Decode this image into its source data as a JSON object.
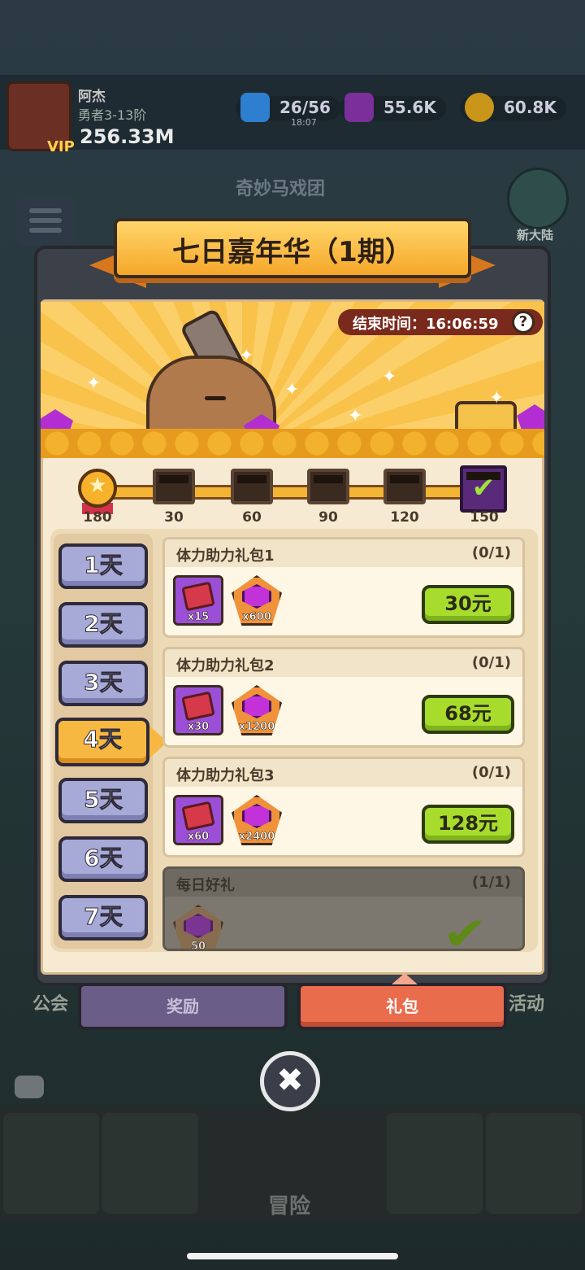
{
  "background": {
    "player_name": "阿杰",
    "player_rank": "勇者3-13阶",
    "vip_label": "VIP",
    "power": "256.33M",
    "stamina": "26/56",
    "stamina_timer": "18:07",
    "gems": "55.6K",
    "gold": "60.8K",
    "stage_title": "奇妙马戏团",
    "new_land_label": "新大陆",
    "guild_label": "公会",
    "activity_label": "活动",
    "adventure_label": "冒险"
  },
  "modal": {
    "title": "七日嘉年华（1期）",
    "end_time_label": "结束时间：16:06:59",
    "help_icon": "question-mark-icon"
  },
  "progress": {
    "current_points": 180,
    "milestones": [
      "30",
      "60",
      "90",
      "120",
      "150"
    ],
    "start_label": "180"
  },
  "days": [
    "1天",
    "2天",
    "3天",
    "4天",
    "5天",
    "6天",
    "7天"
  ],
  "active_day_index": 3,
  "offers": [
    {
      "title": "体力助力礼包1",
      "count": "(0/1)",
      "items": [
        {
          "icon": "ticket-icon",
          "qty": "x15"
        },
        {
          "icon": "gem-icon",
          "qty": "x600"
        }
      ],
      "price": "30元"
    },
    {
      "title": "体力助力礼包2",
      "count": "(0/1)",
      "items": [
        {
          "icon": "ticket-icon",
          "qty": "x30"
        },
        {
          "icon": "gem-icon",
          "qty": "x1200"
        }
      ],
      "price": "68元"
    },
    {
      "title": "体力助力礼包3",
      "count": "(0/1)",
      "items": [
        {
          "icon": "ticket-icon",
          "qty": "x60"
        },
        {
          "icon": "gem-icon",
          "qty": "x2400"
        }
      ],
      "price": "128元"
    },
    {
      "title": "每日好礼",
      "count": "(1/1)",
      "items": [
        {
          "icon": "gem-icon",
          "qty": "50"
        }
      ],
      "claimed": true
    }
  ],
  "bottom_tabs": {
    "rewards": "奖励",
    "packs": "礼包"
  },
  "close_glyph": "✖"
}
